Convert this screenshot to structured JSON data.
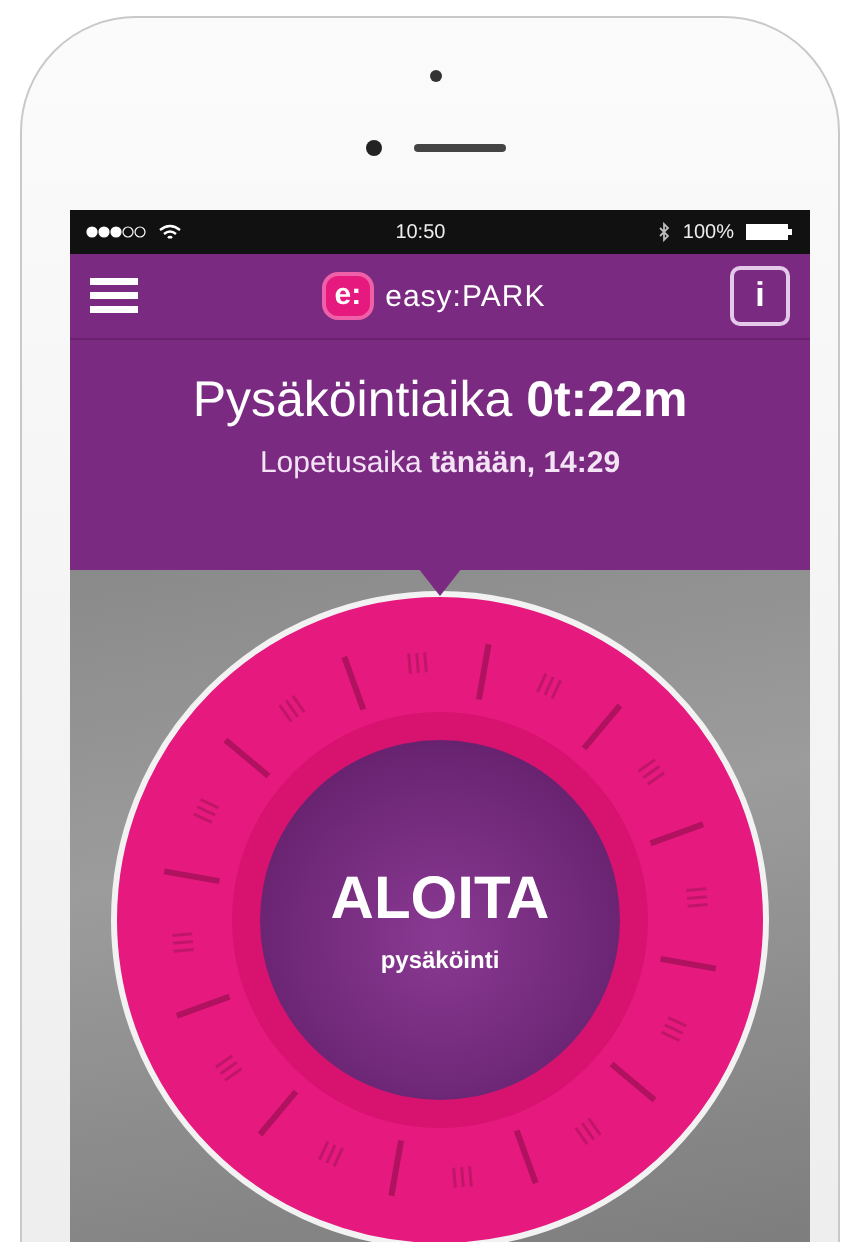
{
  "status_bar": {
    "time": "10:50",
    "battery": "100%"
  },
  "header": {
    "logo": {
      "mark": "e:",
      "name": "easy:PARK"
    },
    "info_button": "i"
  },
  "parking": {
    "title": "Pysäköintiaika **0t:22m**",
    "end_time": "Lopetusaika **tänään, 14:29**"
  },
  "dial": {
    "title": "ALOITA",
    "subtitle": "pysäköinti"
  }
}
